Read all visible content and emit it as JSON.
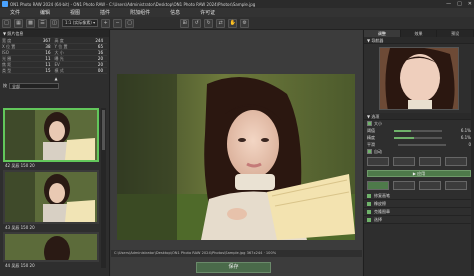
{
  "window": {
    "title": "ON1 Photo RAW 2024 (64-bit) - ON1 Photo RAW - C:\\Users\\Administrator\\Desktop\\ON1 Photo RAW 2024\\Photos\\Sample.jpg"
  },
  "menu": [
    "文件",
    "编辑",
    "视图",
    "插件",
    "附加组件",
    "信息",
    "许可证"
  ],
  "toolbar": {
    "preset_select": "1:1 (实际像素) ▾"
  },
  "left": {
    "header": "▼ 照片信息",
    "info": [
      {
        "k": "宽 度",
        "v": "367"
      },
      {
        "k": "高 度",
        "v": "244"
      },
      {
        "k": "X 位 置",
        "v": "38"
      },
      {
        "k": "Y 位 置",
        "v": "65"
      },
      {
        "k": "ISO",
        "v": "16"
      },
      {
        "k": "大 小",
        "v": "16"
      },
      {
        "k": "光 圈",
        "v": "11"
      },
      {
        "k": "曝 光",
        "v": "20"
      },
      {
        "k": "焦 距",
        "v": "11"
      },
      {
        "k": "EV",
        "v": "20"
      },
      {
        "k": "类 型",
        "v": "15"
      },
      {
        "k": "模 式",
        "v": "00"
      }
    ],
    "row1_label": "▲",
    "sort_label": "按",
    "sort_value": "全部",
    "thumbs": [
      {
        "caption": "42 吴辰 150 20"
      },
      {
        "caption": "43 吴辰 150 20"
      },
      {
        "caption": "44 吴辰 150 20"
      }
    ]
  },
  "center": {
    "status": "C:\\Users\\Administrator\\Desktop\\ON1 Photo RAW 2024\\Photos\\Sample.jpg  367x244  ·  100%",
    "save_label": "保存"
  },
  "right": {
    "tabs": [
      "调整",
      "效果",
      "预设"
    ],
    "navigator_title": "▼ 导航器",
    "options_title": "▼ 选项",
    "size_label": "大小",
    "rows": [
      {
        "label": "阈值",
        "value": "6.1%",
        "level": 0.35
      },
      {
        "label": "精度",
        "value": "6.1%",
        "level": 0.42
      },
      {
        "label": "平滑",
        "value": "0",
        "level": 0.0
      }
    ],
    "auto_label": "自动",
    "apply_button": "▶ 应用",
    "items": [
      "修复画笔",
      "橡皮擦",
      "克隆图章",
      "选择"
    ]
  }
}
